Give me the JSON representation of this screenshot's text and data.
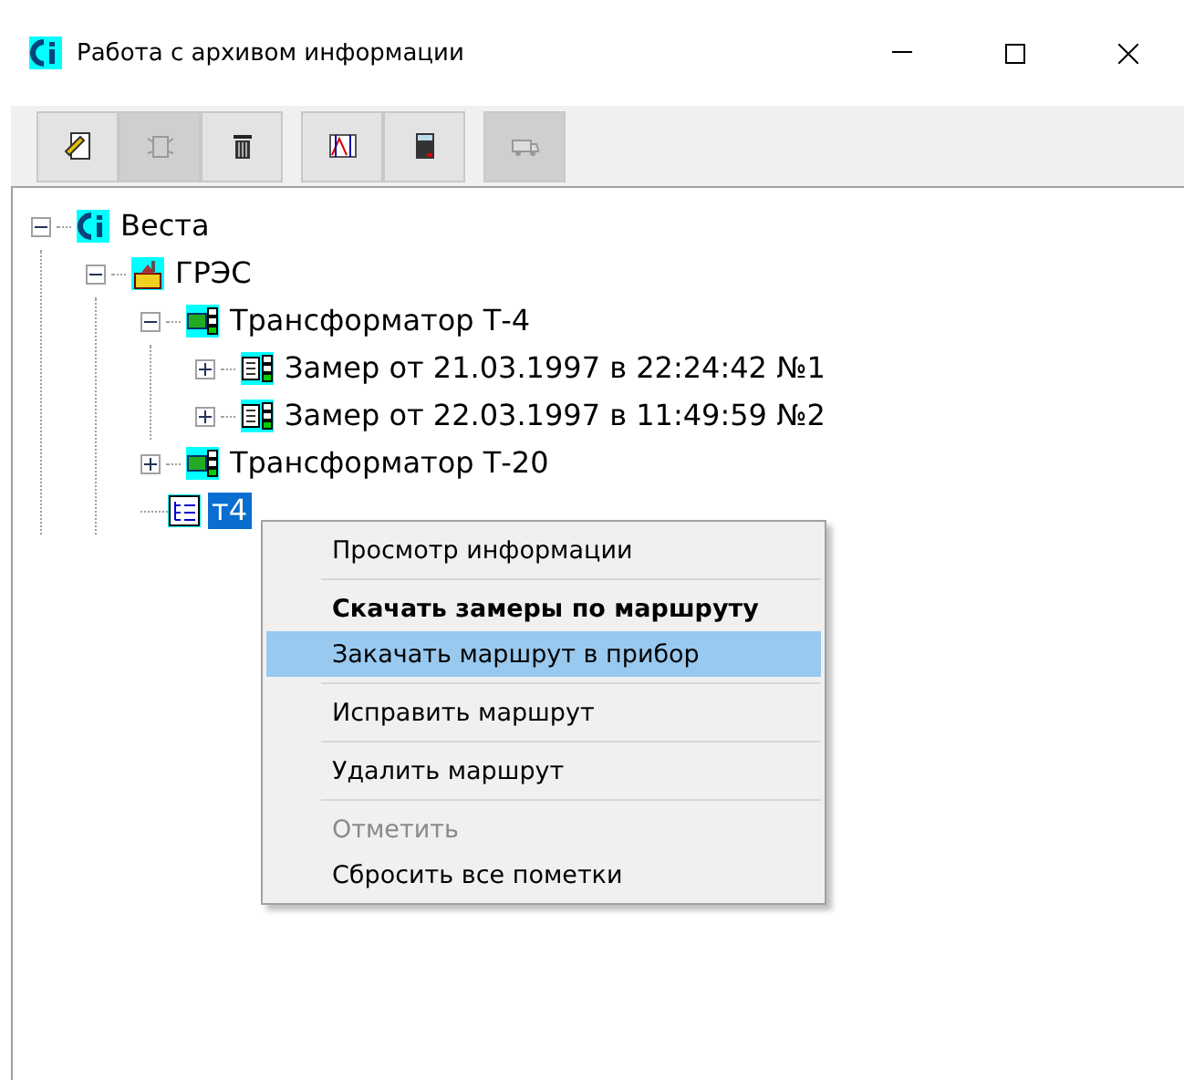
{
  "window": {
    "title": "Работа с архивом информации"
  },
  "toolbar": [
    {
      "kind": "edit",
      "disabled": false
    },
    {
      "kind": "bug",
      "disabled": true
    },
    {
      "kind": "trash",
      "disabled": false
    },
    {
      "kind": "chart",
      "disabled": false
    },
    {
      "kind": "calculator",
      "disabled": false
    },
    {
      "kind": "truck",
      "disabled": true
    }
  ],
  "tree": [
    {
      "label": "Веста",
      "kind": "app",
      "expanded": true,
      "selected": false,
      "children": [
        {
          "label": "ГРЭС",
          "kind": "plant",
          "expanded": true,
          "selected": false,
          "children": [
            {
              "label": "Трансформатор Т-4",
              "kind": "transformer",
              "expanded": true,
              "selected": false,
              "children": [
                {
                  "label": "Замер от 21.03.1997 в 22:24:42  №1",
                  "kind": "measurement",
                  "expanded": false,
                  "selected": false
                },
                {
                  "label": "Замер от 22.03.1997 в 11:49:59  №2",
                  "kind": "measurement",
                  "expanded": false,
                  "selected": false
                }
              ]
            },
            {
              "label": "Трансформатор Т-20",
              "kind": "transformer",
              "expanded": false,
              "selected": false
            },
            {
              "label": "т4",
              "kind": "route",
              "selected": true
            }
          ]
        }
      ]
    }
  ],
  "context_menu": [
    {
      "label": "Просмотр информации",
      "bold": false,
      "disabled": false,
      "selected": false,
      "separator_after": true
    },
    {
      "label": "Скачать замеры по маршруту",
      "bold": true,
      "disabled": false,
      "selected": false,
      "separator_after": false
    },
    {
      "label": "Закачать маршрут в прибор",
      "bold": false,
      "disabled": false,
      "selected": true,
      "separator_after": true
    },
    {
      "label": "Исправить маршрут",
      "bold": false,
      "disabled": false,
      "selected": false,
      "separator_after": true
    },
    {
      "label": "Удалить маршрут",
      "bold": false,
      "disabled": false,
      "selected": false,
      "separator_after": true
    },
    {
      "label": "Отметить",
      "bold": false,
      "disabled": true,
      "selected": false,
      "separator_after": false
    },
    {
      "label": "Сбросить все пометки",
      "bold": false,
      "disabled": false,
      "selected": false,
      "separator_after": false
    }
  ]
}
